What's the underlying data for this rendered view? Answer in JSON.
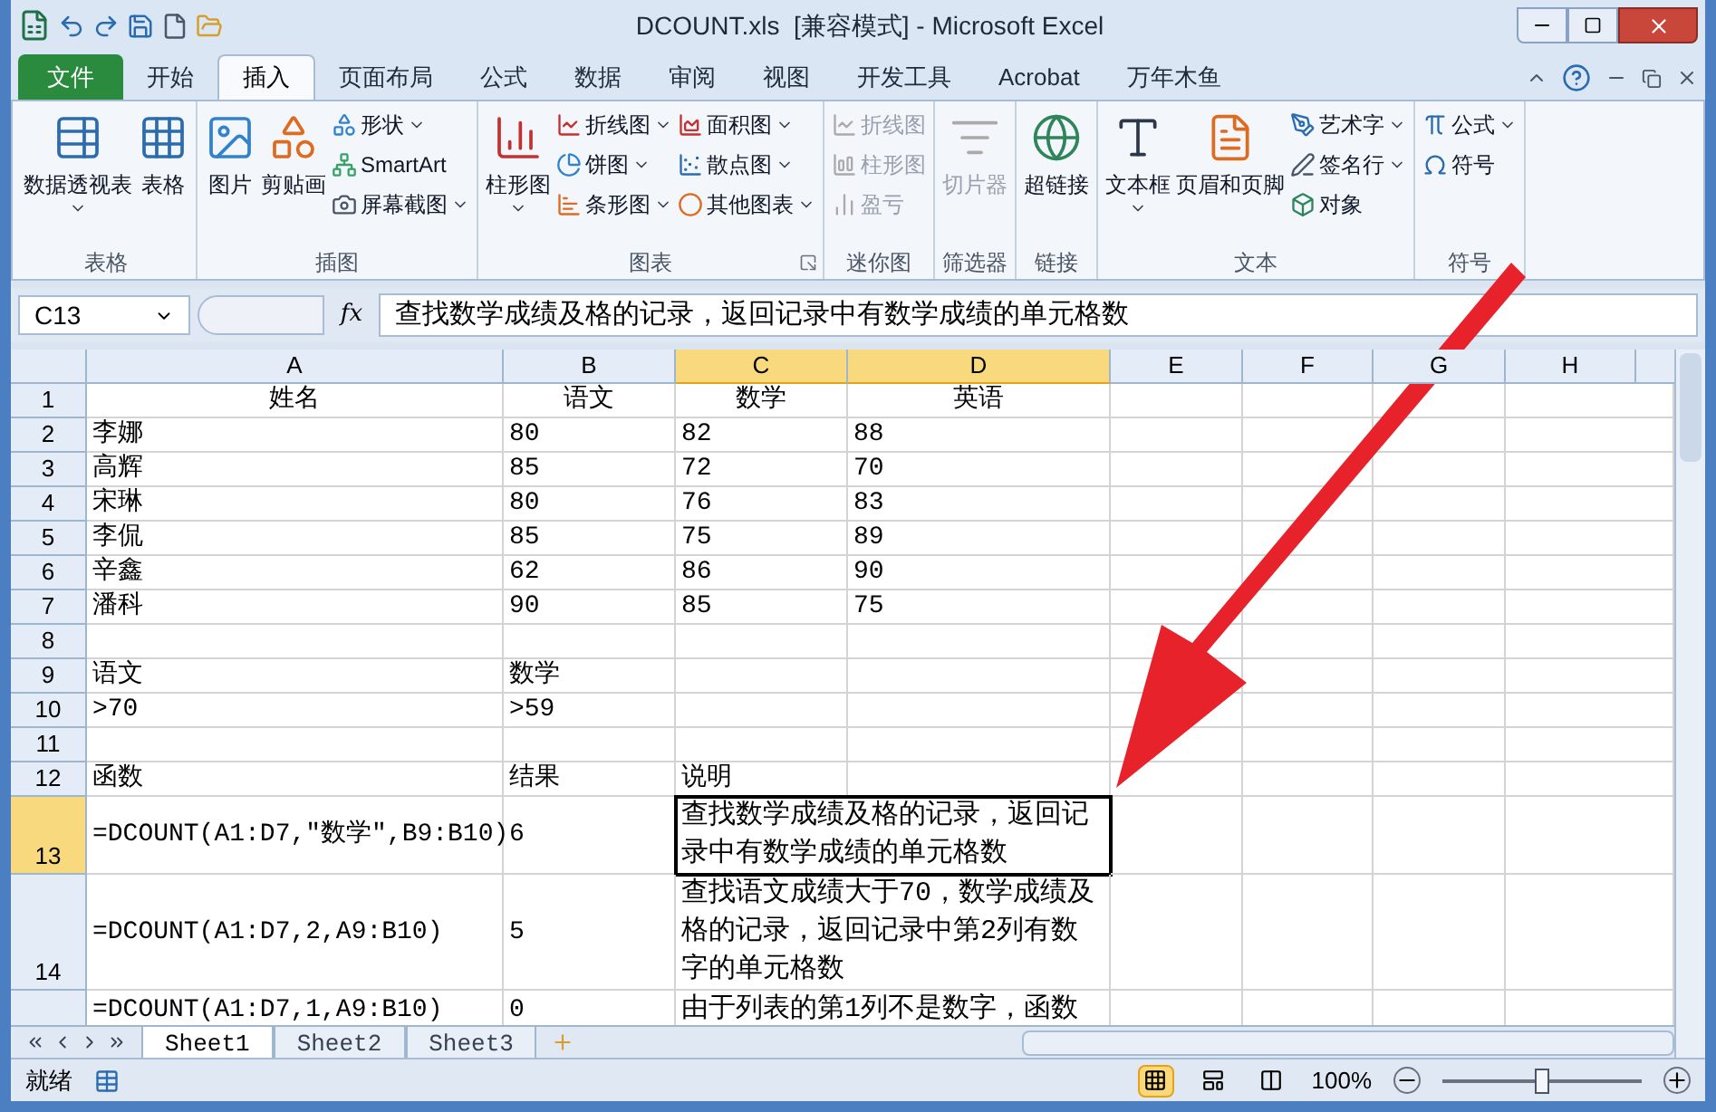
{
  "window": {
    "title": "DCOUNT.xls  [兼容模式] - Microsoft Excel"
  },
  "ribbon_tabs": [
    {
      "label": "文件",
      "kind": "file",
      "selected": false
    },
    {
      "label": "开始",
      "kind": "tab",
      "selected": false
    },
    {
      "label": "插入",
      "kind": "tab",
      "selected": true
    },
    {
      "label": "页面布局",
      "kind": "tab",
      "selected": false
    },
    {
      "label": "公式",
      "kind": "tab",
      "selected": false
    },
    {
      "label": "数据",
      "kind": "tab",
      "selected": false
    },
    {
      "label": "审阅",
      "kind": "tab",
      "selected": false
    },
    {
      "label": "视图",
      "kind": "tab",
      "selected": false
    },
    {
      "label": "开发工具",
      "kind": "tab",
      "selected": false
    },
    {
      "label": "Acrobat",
      "kind": "tab",
      "selected": false
    },
    {
      "label": "万年木鱼",
      "kind": "tab",
      "selected": false
    }
  ],
  "ribbon_groups": [
    {
      "label": "表格",
      "launcher": false,
      "items": [
        {
          "label": "数据透视表",
          "kind": "large",
          "dropdown": true,
          "disabled": false
        },
        {
          "label": "表格",
          "kind": "large",
          "dropdown": false,
          "disabled": false
        }
      ]
    },
    {
      "label": "插图",
      "launcher": false,
      "items": [
        {
          "label": "图片",
          "kind": "large",
          "dropdown": false,
          "disabled": false
        },
        {
          "label": "剪贴画",
          "kind": "large",
          "dropdown": false,
          "disabled": false
        },
        {
          "label": "形状",
          "kind": "small",
          "dropdown": true,
          "disabled": false
        },
        {
          "label": "SmartArt",
          "kind": "small",
          "dropdown": false,
          "disabled": false
        },
        {
          "label": "屏幕截图",
          "kind": "small",
          "dropdown": true,
          "disabled": false
        }
      ]
    },
    {
      "label": "图表",
      "launcher": true,
      "items": [
        {
          "label": "柱形图",
          "kind": "large",
          "dropdown": true,
          "disabled": false
        },
        {
          "label": "折线图",
          "kind": "small",
          "dropdown": true,
          "disabled": false
        },
        {
          "label": "饼图",
          "kind": "small",
          "dropdown": true,
          "disabled": false
        },
        {
          "label": "条形图",
          "kind": "small",
          "dropdown": true,
          "disabled": false
        },
        {
          "label": "面积图",
          "kind": "small",
          "dropdown": true,
          "disabled": false
        },
        {
          "label": "散点图",
          "kind": "small",
          "dropdown": true,
          "disabled": false
        },
        {
          "label": "其他图表",
          "kind": "small",
          "dropdown": true,
          "disabled": false
        }
      ]
    },
    {
      "label": "迷你图",
      "launcher": false,
      "items": [
        {
          "label": "折线图",
          "kind": "small",
          "dropdown": false,
          "disabled": true
        },
        {
          "label": "柱形图",
          "kind": "small",
          "dropdown": false,
          "disabled": true
        },
        {
          "label": "盈亏",
          "kind": "small",
          "dropdown": false,
          "disabled": true
        }
      ]
    },
    {
      "label": "筛选器",
      "launcher": false,
      "items": [
        {
          "label": "切片器",
          "kind": "large",
          "dropdown": false,
          "disabled": true
        }
      ]
    },
    {
      "label": "链接",
      "launcher": false,
      "items": [
        {
          "label": "超链接",
          "kind": "large",
          "dropdown": false,
          "disabled": false
        }
      ]
    },
    {
      "label": "文本",
      "launcher": false,
      "items": [
        {
          "label": "文本框",
          "kind": "large",
          "dropdown": true,
          "disabled": false
        },
        {
          "label": "页眉和页脚",
          "kind": "large",
          "dropdown": false,
          "disabled": false
        },
        {
          "label": "艺术字",
          "kind": "small",
          "dropdown": true,
          "disabled": false
        },
        {
          "label": "签名行",
          "kind": "small",
          "dropdown": true,
          "disabled": false
        },
        {
          "label": "对象",
          "kind": "small",
          "dropdown": false,
          "disabled": false
        }
      ]
    },
    {
      "label": "符号",
      "launcher": false,
      "items": [
        {
          "label": "公式",
          "kind": "small",
          "dropdown": true,
          "disabled": false
        },
        {
          "label": "符号",
          "kind": "small",
          "dropdown": false,
          "disabled": false
        }
      ]
    }
  ],
  "formula_bar": {
    "name_box": "C13",
    "function_label": "fx",
    "formula": "查找数学成绩及格的记录，返回记录中有数学成绩的单元格数"
  },
  "columns": [
    {
      "label": "A",
      "selected": false
    },
    {
      "label": "B",
      "selected": false
    },
    {
      "label": "C",
      "selected": true
    },
    {
      "label": "D",
      "selected": true
    },
    {
      "label": "E",
      "selected": false
    },
    {
      "label": "F",
      "selected": false
    },
    {
      "label": "G",
      "selected": false
    },
    {
      "label": "H",
      "selected": false
    }
  ],
  "rows": [
    {
      "number": "1",
      "selected": false,
      "merged": false,
      "header": true,
      "cells": [
        "姓名",
        "语文",
        "数学",
        "英语"
      ]
    },
    {
      "number": "2",
      "selected": false,
      "merged": false,
      "header": false,
      "cells": [
        "李娜",
        "80",
        "82",
        "88"
      ]
    },
    {
      "number": "3",
      "selected": false,
      "merged": false,
      "header": false,
      "cells": [
        "高辉",
        "85",
        "72",
        "70"
      ]
    },
    {
      "number": "4",
      "selected": false,
      "merged": false,
      "header": false,
      "cells": [
        "宋琳",
        "80",
        "76",
        "83"
      ]
    },
    {
      "number": "5",
      "selected": false,
      "merged": false,
      "header": false,
      "cells": [
        "李侃",
        "85",
        "75",
        "89"
      ]
    },
    {
      "number": "6",
      "selected": false,
      "merged": false,
      "header": false,
      "cells": [
        "辛鑫",
        "62",
        "86",
        "90"
      ]
    },
    {
      "number": "7",
      "selected": false,
      "merged": false,
      "header": false,
      "cells": [
        "潘科",
        "90",
        "85",
        "75"
      ]
    },
    {
      "number": "8",
      "selected": false,
      "merged": false,
      "cells": []
    },
    {
      "number": "9",
      "selected": false,
      "merged": false,
      "header": false,
      "cells": [
        "语文",
        "数学"
      ]
    },
    {
      "number": "10",
      "selected": false,
      "merged": false,
      "header": false,
      "cells": [
        ">70",
        ">59"
      ]
    },
    {
      "number": "11",
      "selected": false,
      "merged": false,
      "cells": []
    },
    {
      "number": "12",
      "selected": false,
      "merged": false,
      "header": false,
      "cells": [
        "函数",
        "结果",
        "说明"
      ]
    },
    {
      "number": "13",
      "selected": true,
      "merged": true,
      "header": false,
      "cells": [
        "=DCOUNT(A1:D7,\"数学\",B9:B10)",
        "6",
        "查找数学成绩及格的记录，返回记录中有数学成绩的单元格数"
      ]
    },
    {
      "number": "14",
      "selected": false,
      "merged": true,
      "header": false,
      "cells": [
        "=DCOUNT(A1:D7,2,A9:B10)",
        "5",
        "查找语文成绩大于70，数学成绩及格的记录，返回记录中第2列有数字的单元格数"
      ]
    },
    {
      "number": "",
      "selected": false,
      "merged": true,
      "header": false,
      "cells": [
        "=DCOUNT(A1:D7,1,A9:B10)",
        "0",
        "由于列表的第1列不是数字，函数"
      ]
    }
  ],
  "sheet_tabs": [
    {
      "label": "Sheet1",
      "selected": true
    },
    {
      "label": "Sheet2",
      "selected": false
    },
    {
      "label": "Sheet3",
      "selected": false
    }
  ],
  "status_bar": {
    "status": "就绪",
    "zoom": "100%",
    "zoom_slider": {
      "level": 0.5
    },
    "views": [
      {
        "kind": "normal",
        "selected": true
      },
      {
        "kind": "page-layout",
        "selected": false
      },
      {
        "kind": "page-break",
        "selected": false
      }
    ]
  }
}
